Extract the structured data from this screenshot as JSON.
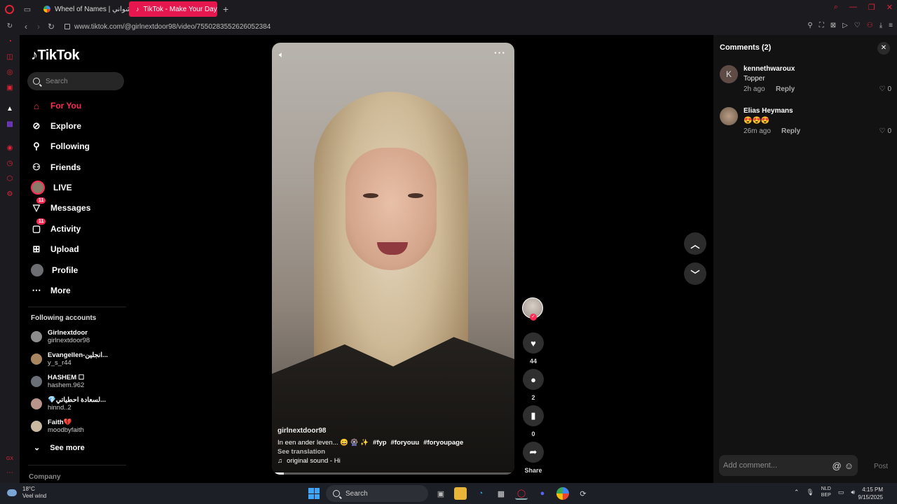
{
  "browser": {
    "tabs": [
      {
        "label": "Wheel of Names | فشواني",
        "active": false
      },
      {
        "label": "TikTok - Make Your Day",
        "active": true
      }
    ],
    "url": "www.tiktok.com/@girlnextdoor98/video/7550283552626052384",
    "accent": "#e5174e"
  },
  "tiktok_nav": {
    "logo": "TikTok",
    "search_placeholder": "Search",
    "menu": [
      {
        "label": "For You",
        "icon": "home-icon",
        "active": true
      },
      {
        "label": "Explore",
        "icon": "compass-icon"
      },
      {
        "label": "Following",
        "icon": "following-icon"
      },
      {
        "label": "Friends",
        "icon": "friends-icon"
      },
      {
        "label": "LIVE",
        "icon": "live-avatar-icon"
      },
      {
        "label": "Messages",
        "icon": "messages-icon",
        "badge": "11"
      },
      {
        "label": "Activity",
        "icon": "activity-icon",
        "badge": "11"
      },
      {
        "label": "Upload",
        "icon": "upload-icon"
      },
      {
        "label": "Profile",
        "icon": "profile-avatar"
      },
      {
        "label": "More",
        "icon": "more-icon"
      }
    ],
    "following_header": "Following accounts",
    "accounts": [
      {
        "name": "Girlnextdoor",
        "handle": "girlnextdoor98"
      },
      {
        "name": "Evangellen-انجلين...",
        "handle": "y_s_r44"
      },
      {
        "name": "HASHEM ☐",
        "handle": "hashem.962"
      },
      {
        "name": "💎لسعادة احطياتي...",
        "handle": "hinnd..2"
      },
      {
        "name": "Faith💔",
        "handle": "moodbyfaith"
      }
    ],
    "see_more": "See more",
    "company": "Company"
  },
  "video": {
    "username": "girlnextdoor98",
    "caption": "In een ander leven... 😄 🎡 ✨",
    "hashtags": [
      "#fyp",
      "#foryouu",
      "#foryoupage"
    ],
    "see_translation": "See translation",
    "sound": "original sound - Hi",
    "progress": 0.05
  },
  "actions": {
    "likes": "44",
    "comments": "2",
    "saves": "0",
    "share_label": "Share"
  },
  "comments_panel": {
    "title": "Comments (2)",
    "items": [
      {
        "avatar_letter": "K",
        "user": "kennethwaroux",
        "text": "Topper",
        "time": "2h ago",
        "reply": "Reply",
        "likes": "0"
      },
      {
        "avatar_letter": "",
        "user": "Elias Heymans",
        "text": "😍😍😍",
        "time": "26m ago",
        "reply": "Reply",
        "likes": "0"
      }
    ],
    "input_placeholder": "Add comment...",
    "post_label": "Post"
  },
  "taskbar": {
    "temp": "18°C",
    "weather": "Veel wind",
    "search_label": "Search",
    "lang_top": "NLD",
    "lang_bottom": "BEP",
    "time": "4:15 PM",
    "date": "9/15/2025"
  }
}
